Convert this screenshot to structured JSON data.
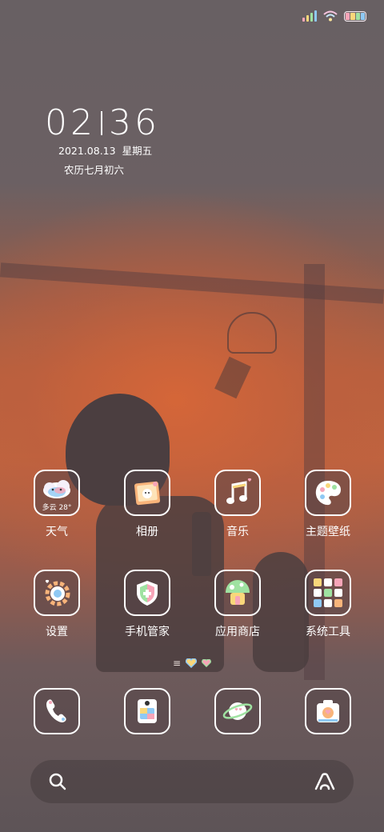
{
  "status_bar": {
    "signal_icon": "signal-bars-icon",
    "wifi_icon": "wifi-icon",
    "battery_icon": "battery-icon"
  },
  "clock": {
    "hour": "02",
    "minute": "36",
    "date": "2021.08.13",
    "weekday": "星期五",
    "lunar": "农历七月初六"
  },
  "apps": [
    {
      "name": "weather",
      "label": "天气",
      "icon": "weather-cloud-icon",
      "weather_text": "多云 28°"
    },
    {
      "name": "gallery",
      "label": "相册",
      "icon": "photo-frame-icon"
    },
    {
      "name": "music",
      "label": "音乐",
      "icon": "music-note-icon"
    },
    {
      "name": "themes",
      "label": "主题壁纸",
      "icon": "palette-icon"
    },
    {
      "name": "settings",
      "label": "设置",
      "icon": "gear-icon"
    },
    {
      "name": "security",
      "label": "手机管家",
      "icon": "shield-icon"
    },
    {
      "name": "app-store",
      "label": "应用商店",
      "icon": "mushroom-house-icon"
    },
    {
      "name": "tools",
      "label": "系统工具",
      "icon": "tools-folder-icon"
    }
  ],
  "dock": [
    {
      "name": "phone",
      "icon": "phone-icon"
    },
    {
      "name": "messages",
      "icon": "message-card-icon"
    },
    {
      "name": "browser",
      "icon": "planet-icon"
    },
    {
      "name": "camera",
      "icon": "camera-icon"
    }
  ],
  "search": {
    "search_icon": "search-icon",
    "assistant_icon": "assistant-logo-icon"
  }
}
